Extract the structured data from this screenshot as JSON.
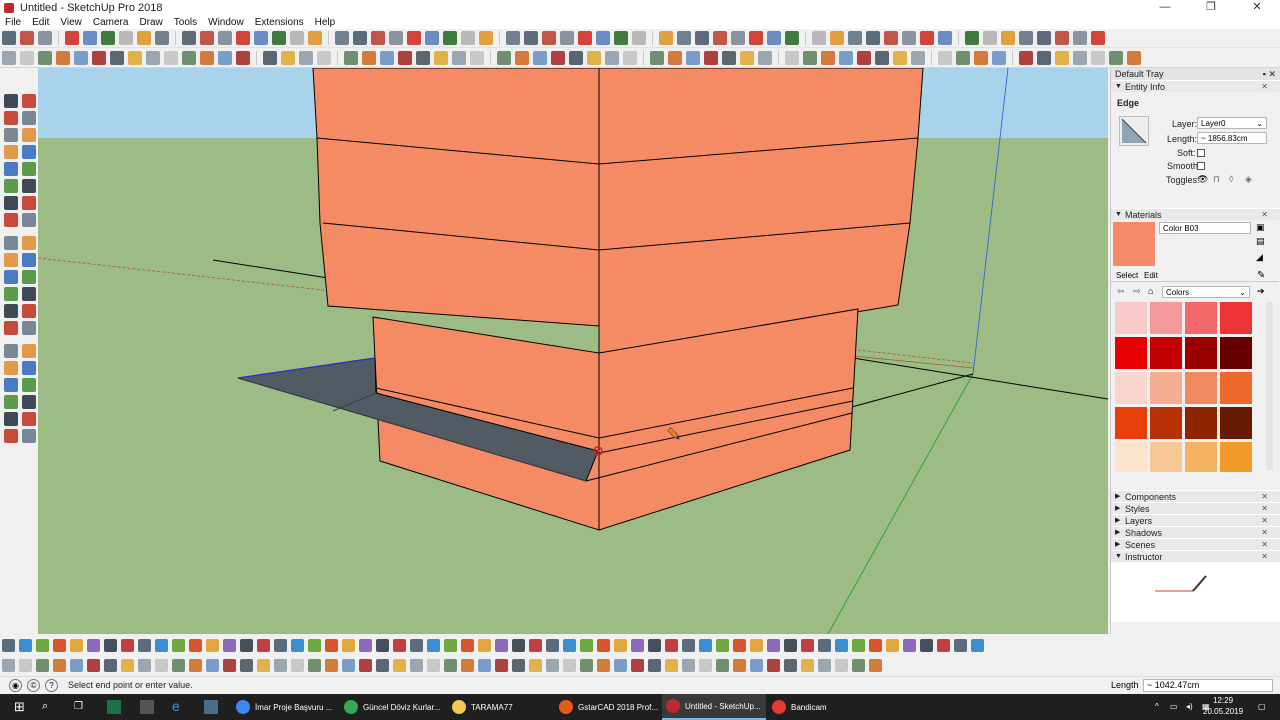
{
  "window": {
    "title": "Untitled - SketchUp Pro 2018",
    "controls": [
      "—",
      "❐",
      "✕"
    ]
  },
  "menu": [
    "File",
    "Edit",
    "View",
    "Camera",
    "Draw",
    "Tools",
    "Window",
    "Extensions",
    "Help"
  ],
  "tray": {
    "title": "Default Tray",
    "entity_info": {
      "title": "Entity Info",
      "type": "Edge",
      "layer_label": "Layer:",
      "layer_value": "Layer0",
      "length_label": "Length:",
      "length_value": "~ 1856.83cm",
      "soft_label": "Soft:",
      "smooth_label": "Smooth:",
      "toggles_label": "Toggles:"
    },
    "materials": {
      "title": "Materials",
      "name": "Color B03",
      "preview_color": "#f4896b",
      "tab_select": "Select",
      "tab_edit": "Edit",
      "library": "Colors",
      "swatches": [
        "#f7c9c9",
        "#f49a9a",
        "#f06868",
        "#ec3434",
        "#e60000",
        "#c30000",
        "#990000",
        "#660000",
        "#f8d6cd",
        "#f4ad92",
        "#f08a5e",
        "#ee6a2c",
        "#e63f0a",
        "#b93204",
        "#8c2500",
        "#661a00",
        "#fbe3cd",
        "#f7c794",
        "#f4b160",
        "#f09a2a"
      ]
    },
    "collapsed_panels": [
      "Components",
      "Styles",
      "Layers",
      "Shadows",
      "Scenes"
    ],
    "instructor": {
      "title": "Instructor"
    }
  },
  "status": {
    "hint": "Select end point or enter value.",
    "vcb_label": "Length",
    "vcb_value": "~ 1042.47cm"
  },
  "taskbar": {
    "items": [
      {
        "label": "İmar Proje Başvuru ...",
        "color": "#4285f4"
      },
      {
        "label": "Güncel Döviz Kurlar...",
        "color": "#34a853"
      },
      {
        "label": "TARAMA77",
        "color": "#f2c94c"
      },
      {
        "label": "GstarCAD 2018 Prof...",
        "color": "#e85a1b"
      },
      {
        "label": "Untitled - SketchUp...",
        "color": "#c0282f"
      },
      {
        "label": "Bandicam",
        "color": "#e53935"
      }
    ],
    "time": "12:29",
    "date": "20.05.2019"
  },
  "colors": {
    "sky": "#a9d3ea",
    "ground": "#9cbb85",
    "building": "#f48b65",
    "shadow_face": "#525a64"
  }
}
